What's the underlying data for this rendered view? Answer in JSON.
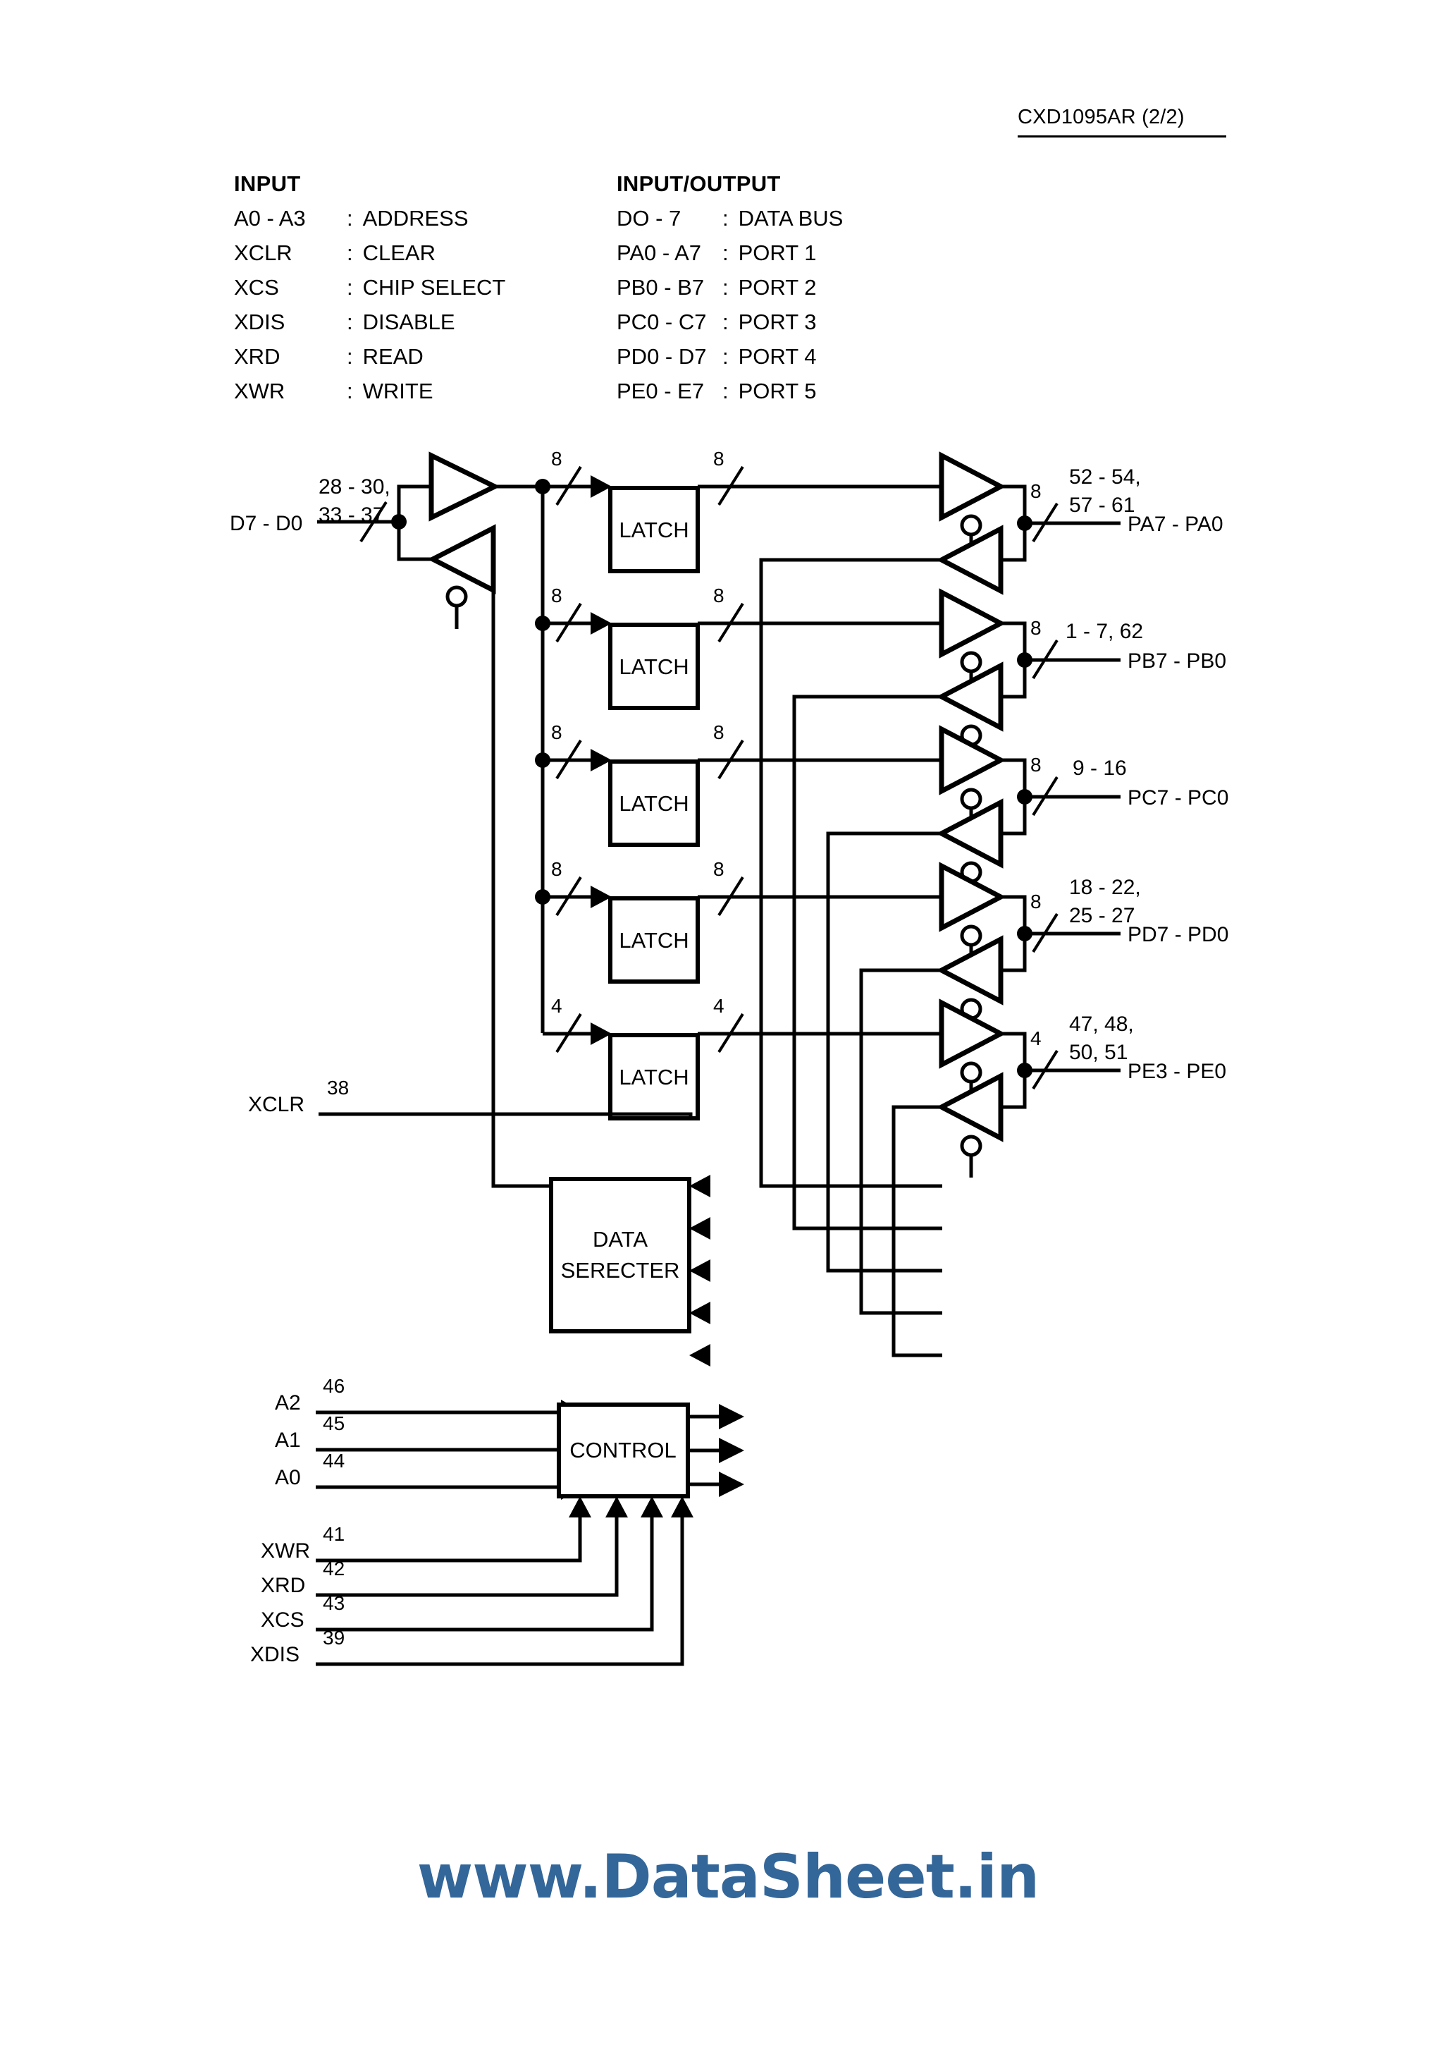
{
  "header": {
    "title": "CXD1095AR (2/2)"
  },
  "legend": {
    "input": {
      "heading": "INPUT",
      "rows": [
        {
          "signal": "A0 - A3",
          "sep": ":",
          "desc": "ADDRESS"
        },
        {
          "signal": "XCLR",
          "sep": ":",
          "desc": "CLEAR"
        },
        {
          "signal": "XCS",
          "sep": ":",
          "desc": "CHIP SELECT"
        },
        {
          "signal": "XDIS",
          "sep": ":",
          "desc": "DISABLE"
        },
        {
          "signal": "XRD",
          "sep": ":",
          "desc": "READ"
        },
        {
          "signal": "XWR",
          "sep": ":",
          "desc": "WRITE"
        }
      ]
    },
    "inputoutput": {
      "heading": "INPUT/OUTPUT",
      "rows": [
        {
          "signal": "DO - 7",
          "sep": ":",
          "desc": "DATA BUS"
        },
        {
          "signal": "PA0 - A7",
          "sep": ":",
          "desc": "PORT 1"
        },
        {
          "signal": "PB0 - B7",
          "sep": ":",
          "desc": "PORT 2"
        },
        {
          "signal": "PC0 - C7",
          "sep": ":",
          "desc": "PORT 3"
        },
        {
          "signal": "PD0 - D7",
          "sep": ":",
          "desc": "PORT 4"
        },
        {
          "signal": "PE0 - E7",
          "sep": ":",
          "desc": "PORT 5"
        }
      ]
    }
  },
  "diagram": {
    "data_bus": {
      "label": "D7 - D0",
      "pins_line1": "28 - 30,",
      "pins_line2": "33 - 37"
    },
    "latch_label": "LATCH",
    "data_selector": {
      "line1": "DATA",
      "line2": "SERECTER"
    },
    "control_label": "CONTROL",
    "xclr": {
      "label": "XCLR",
      "pin": "38"
    },
    "ports": [
      {
        "name": "PA7 - PA0",
        "width": "8",
        "bus_in": "8",
        "bus_out": "8",
        "pins_line1": "52 - 54,",
        "pins_line2": "57 - 61"
      },
      {
        "name": "PB7 - PB0",
        "width": "8",
        "bus_in": "8",
        "bus_out": "8",
        "pins_line1": "1 - 7, 62",
        "pins_line2": ""
      },
      {
        "name": "PC7 - PC0",
        "width": "8",
        "bus_in": "8",
        "bus_out": "8",
        "pins_line1": "9 - 16",
        "pins_line2": ""
      },
      {
        "name": "PD7 - PD0",
        "width": "8",
        "bus_in": "8",
        "bus_out": "8",
        "pins_line1": "18 - 22,",
        "pins_line2": "25 - 27"
      },
      {
        "name": "PE3 - PE0",
        "width": "4",
        "bus_in": "4",
        "bus_out": "4",
        "pins_line1": "47, 48,",
        "pins_line2": "50, 51"
      }
    ],
    "address_inputs": [
      {
        "label": "A2",
        "pin": "46"
      },
      {
        "label": "A1",
        "pin": "45"
      },
      {
        "label": "A0",
        "pin": "44"
      }
    ],
    "control_inputs": [
      {
        "label": "XWR",
        "pin": "41"
      },
      {
        "label": "XRD",
        "pin": "42"
      },
      {
        "label": "XCS",
        "pin": "43"
      },
      {
        "label": "XDIS",
        "pin": "39"
      }
    ]
  },
  "watermark": {
    "text": "www.DataSheet.in",
    "color": "#336699"
  }
}
